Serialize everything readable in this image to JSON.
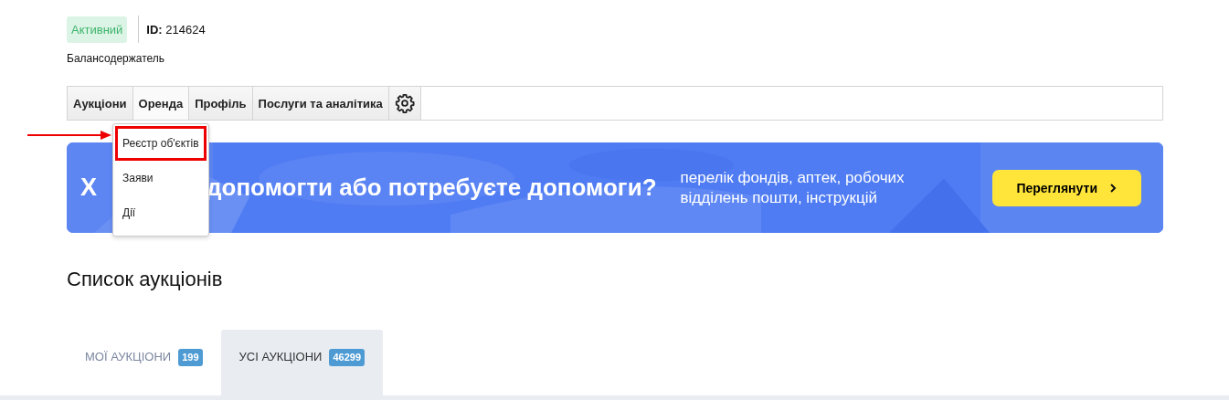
{
  "header": {
    "status": "Активний",
    "id_label": "ID:",
    "id_value": "214624",
    "role": "Балансодержатель"
  },
  "nav": [
    {
      "label": "Аукціони",
      "open": false
    },
    {
      "label": "Оренда",
      "open": true
    },
    {
      "label": "Профіль",
      "open": false
    },
    {
      "label": "Послуги та аналітика",
      "open": false
    },
    {
      "kind": "settings",
      "open": false
    }
  ],
  "dropdown": [
    {
      "label": "Реєстр об'єктів",
      "highlighted": true
    },
    {
      "label": "Заяви",
      "highlighted": false
    },
    {
      "label": "Дії",
      "highlighted": false
    }
  ],
  "banner": {
    "kind": "picture",
    "headline_start": "Х",
    "headline": "допомогти або потребуєте допомоги?",
    "text": "перелік фондів, аптек, робочих відділень пошти, інструкцій",
    "button": "Переглянути"
  },
  "title": "Список аукціонів",
  "tabs": [
    {
      "label": "МОЇ АУКЦІОНИ",
      "count": "199",
      "selected": false
    },
    {
      "label": "УСІ АУКЦІОНИ",
      "count": "46299",
      "selected": true
    }
  ]
}
